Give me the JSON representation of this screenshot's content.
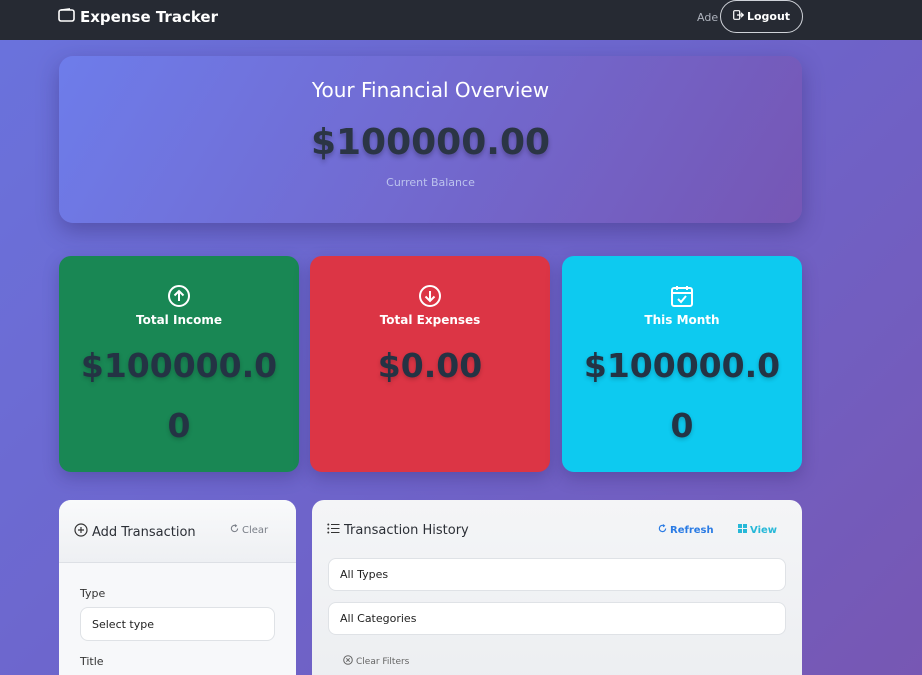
{
  "navbar": {
    "brand": "Expense Tracker",
    "user": "Ade",
    "logout_label": "Logout"
  },
  "overview": {
    "title": "Your Financial Overview",
    "balance": "$100000.00",
    "label": "Current Balance"
  },
  "stats": {
    "income": {
      "label": "Total Income",
      "value": "$100000.00",
      "icon": "arrow-up-circle-icon"
    },
    "expense": {
      "label": "Total Expenses",
      "value": "$0.00",
      "icon": "arrow-down-circle-icon"
    },
    "month": {
      "label": "This Month",
      "value": "$100000.00",
      "icon": "calendar-check-icon"
    }
  },
  "add_transaction": {
    "title": "Add Transaction",
    "clear_label": "Clear",
    "type_label": "Type",
    "type_placeholder": "Select type",
    "title_label": "Title"
  },
  "history": {
    "title": "Transaction History",
    "refresh_label": "Refresh",
    "view_label": "View",
    "type_filter": "All Types",
    "category_filter": "All Categories",
    "clear_filters_label": "Clear Filters"
  },
  "colors": {
    "income": "#198754",
    "expense": "#dc3545",
    "month": "#0dcaf0",
    "navbar": "#262a33"
  }
}
